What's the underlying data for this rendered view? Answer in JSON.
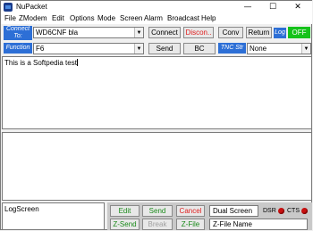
{
  "window": {
    "title": "NuPacket",
    "minimize": "—",
    "maximize": "☐",
    "close": "✕"
  },
  "menu": [
    "File",
    "ZModem",
    "Edit",
    "Options",
    "Mode",
    "Screen",
    "Alarm",
    "Broadcast",
    "Help"
  ],
  "connect_row": {
    "label": "Connect To:",
    "value": "WD6CNF bla",
    "connect": "Connect",
    "disconnect": "Discon..",
    "conv": "Conv",
    "return": "Return",
    "log_label": "Log",
    "log_state": "OFF"
  },
  "function_row": {
    "label": "Function",
    "value": "F6",
    "send": "Send",
    "bc": "BC",
    "tnc_label": "TNC Str",
    "tnc_value": "None"
  },
  "upper_text": "This is a Softpedia test",
  "log_screen": "LogScreen",
  "bottom": {
    "edit": "Edit",
    "send": "Send",
    "cancel": "Cancel",
    "dual_screen": "Dual Screen",
    "dsr": "DSR",
    "cts": "CTS",
    "z_send": "Z-Send",
    "break": "Break",
    "z_file": "Z-File",
    "z_file_name": "Z-File Name"
  },
  "colors": {
    "label_blue": "#2d6fd6",
    "log_off_green": "#15c21a",
    "led_red": "#c81010"
  }
}
